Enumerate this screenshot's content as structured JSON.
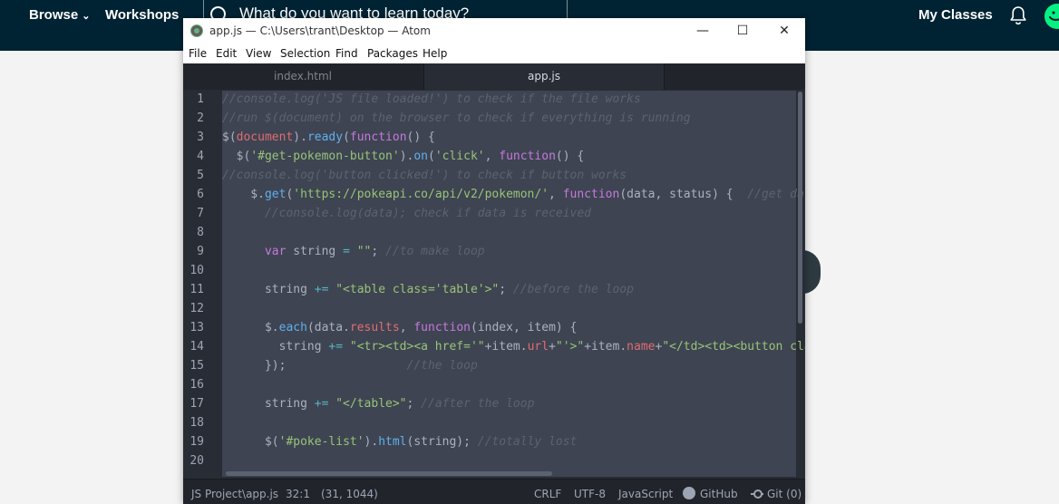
{
  "site": {
    "nav_browse": "Browse",
    "nav_workshops": "Workshops",
    "search_placeholder": "What do you want to learn today?",
    "nav_my_classes": "My Classes"
  },
  "window": {
    "title": "app.js — C:\\Users\\trant\\Desktop — Atom",
    "min_glyph": "—",
    "max_glyph": "☐",
    "close_glyph": "✕"
  },
  "menu": [
    "File",
    "Edit",
    "View",
    "Selection",
    "Find",
    "Packages",
    "Help"
  ],
  "tabs": [
    "index.html",
    "app.js"
  ],
  "editor": {
    "line_numbers": [
      "1",
      "2",
      "3",
      "4",
      "5",
      "6",
      "7",
      "8",
      "9",
      "10",
      "11",
      "12",
      "13",
      "14",
      "15",
      "16",
      "17",
      "18",
      "19",
      "20"
    ],
    "lines": [
      [
        {
          "t": "//console.log('JS file loaded!') to check if the file works",
          "c": "cm"
        }
      ],
      [
        {
          "t": "//run $(document) on the browser to check if everything is running",
          "c": "cm"
        }
      ],
      [
        {
          "t": "$",
          "c": "plain"
        },
        {
          "t": "(",
          "c": "plain"
        },
        {
          "t": "document",
          "c": "var"
        },
        {
          "t": ").",
          "c": "plain"
        },
        {
          "t": "ready",
          "c": "fn"
        },
        {
          "t": "(",
          "c": "plain"
        },
        {
          "t": "function",
          "c": "kw"
        },
        {
          "t": "() {",
          "c": "plain"
        }
      ],
      [
        {
          "t": "  $(",
          "c": "plain"
        },
        {
          "t": "'#get-pokemon-button'",
          "c": "str"
        },
        {
          "t": ").",
          "c": "plain"
        },
        {
          "t": "on",
          "c": "fn"
        },
        {
          "t": "(",
          "c": "plain"
        },
        {
          "t": "'click'",
          "c": "str"
        },
        {
          "t": ", ",
          "c": "plain"
        },
        {
          "t": "function",
          "c": "kw"
        },
        {
          "t": "() {",
          "c": "plain"
        }
      ],
      [
        {
          "t": "//console.log('button clicked!') to check if button works",
          "c": "cm"
        }
      ],
      [
        {
          "t": "    $.",
          "c": "plain"
        },
        {
          "t": "get",
          "c": "fn"
        },
        {
          "t": "(",
          "c": "plain"
        },
        {
          "t": "'https://pokeapi.co/api/v2/pokemon/'",
          "c": "str"
        },
        {
          "t": ", ",
          "c": "plain"
        },
        {
          "t": "function",
          "c": "kw"
        },
        {
          "t": "(data, status) {  ",
          "c": "plain"
        },
        {
          "t": "//get data",
          "c": "cm"
        }
      ],
      [
        {
          "t": "      ",
          "c": "plain"
        },
        {
          "t": "//console.log(data); check if data is received",
          "c": "cm"
        }
      ],
      [],
      [
        {
          "t": "      ",
          "c": "plain"
        },
        {
          "t": "var",
          "c": "kw"
        },
        {
          "t": " string ",
          "c": "plain"
        },
        {
          "t": "=",
          "c": "op"
        },
        {
          "t": " ",
          "c": "plain"
        },
        {
          "t": "\"\"",
          "c": "str"
        },
        {
          "t": "; ",
          "c": "plain"
        },
        {
          "t": "//to make loop",
          "c": "cm"
        }
      ],
      [],
      [
        {
          "t": "      string ",
          "c": "plain"
        },
        {
          "t": "+=",
          "c": "op"
        },
        {
          "t": " ",
          "c": "plain"
        },
        {
          "t": "\"<table class='table'>\"",
          "c": "str"
        },
        {
          "t": "; ",
          "c": "plain"
        },
        {
          "t": "//before the loop",
          "c": "cm"
        }
      ],
      [],
      [
        {
          "t": "      $.",
          "c": "plain"
        },
        {
          "t": "each",
          "c": "fn"
        },
        {
          "t": "(data.",
          "c": "plain"
        },
        {
          "t": "results",
          "c": "var"
        },
        {
          "t": ", ",
          "c": "plain"
        },
        {
          "t": "function",
          "c": "kw"
        },
        {
          "t": "(index, item) {",
          "c": "plain"
        }
      ],
      [
        {
          "t": "        string ",
          "c": "plain"
        },
        {
          "t": "+=",
          "c": "op"
        },
        {
          "t": " ",
          "c": "plain"
        },
        {
          "t": "\"<tr><td><a href='\"",
          "c": "str"
        },
        {
          "t": "+item.",
          "c": "plain"
        },
        {
          "t": "url",
          "c": "var"
        },
        {
          "t": "+",
          "c": "plain"
        },
        {
          "t": "\"'>\"",
          "c": "str"
        },
        {
          "t": "+item.",
          "c": "plain"
        },
        {
          "t": "name",
          "c": "var"
        },
        {
          "t": "+",
          "c": "plain"
        },
        {
          "t": "\"</td><td><button class",
          "c": "str"
        }
      ],
      [
        {
          "t": "      });                 ",
          "c": "plain"
        },
        {
          "t": "//the loop",
          "c": "cm"
        }
      ],
      [],
      [
        {
          "t": "      string ",
          "c": "plain"
        },
        {
          "t": "+=",
          "c": "op"
        },
        {
          "t": " ",
          "c": "plain"
        },
        {
          "t": "\"</table>\"",
          "c": "str"
        },
        {
          "t": "; ",
          "c": "plain"
        },
        {
          "t": "//after the loop",
          "c": "cm"
        }
      ],
      [],
      [
        {
          "t": "      $(",
          "c": "plain"
        },
        {
          "t": "'#poke-list'",
          "c": "str"
        },
        {
          "t": ").",
          "c": "plain"
        },
        {
          "t": "html",
          "c": "fn"
        },
        {
          "t": "(string); ",
          "c": "plain"
        },
        {
          "t": "//totally lost",
          "c": "cm"
        }
      ],
      []
    ]
  },
  "status": {
    "file_path": "JS Project\\app.js",
    "cursor": "32:1",
    "selection": "(31, 1044)",
    "line_ending": "CRLF",
    "encoding": "UTF-8",
    "grammar": "JavaScript",
    "github": "GitHub",
    "git": "Git (0)"
  },
  "colors": {
    "site_nav_bg": "#002333",
    "editor_bg": "#282c34",
    "selection_bg": "#3e4451",
    "accent_green": "#05f283"
  },
  "icons": [
    "search-icon",
    "chevron-down-icon",
    "bell-icon",
    "avatar",
    "atom-logo-icon",
    "minimize-icon",
    "maximize-icon",
    "close-icon",
    "github-icon",
    "git-icon",
    "chevron-left-icon"
  ]
}
